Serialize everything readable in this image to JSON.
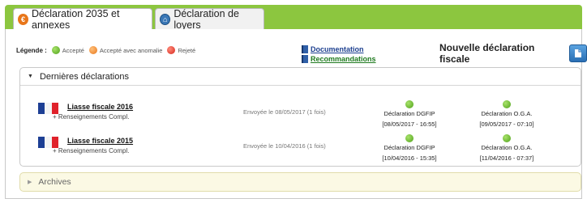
{
  "tabs": [
    {
      "label": "Déclaration 2035 et annexes",
      "icon": "euro-icon",
      "active": true
    },
    {
      "label": "Déclaration de loyers",
      "icon": "home-icon",
      "active": false
    }
  ],
  "legend": {
    "label": "Légende :",
    "items": [
      {
        "label": "Accepté",
        "color": "#4ea01a"
      },
      {
        "label": "Accepté avec anomalie",
        "color": "#e8761a"
      },
      {
        "label": "Rejeté",
        "color": "#d6261b"
      }
    ]
  },
  "links": {
    "documentation": "Documentation",
    "recommandations": "Recommandations"
  },
  "new_declaration": {
    "label": "Nouvelle déclaration fiscale"
  },
  "recent": {
    "title": "Dernières déclarations",
    "rows": [
      {
        "title": "Liasse fiscale 2016",
        "sub": "+ Renseignements Compl.",
        "sent": "Envoyée le 08/05/2017 (1 fois)",
        "dgfip_label": "Déclaration DGFIP",
        "dgfip_date": "[08/05/2017 - 16:55]",
        "oga_label": "Déclaration O.G.A.",
        "oga_date": "[09/05/2017 - 07:10]"
      },
      {
        "title": "Liasse fiscale 2015",
        "sub": "+ Renseignements Compl.",
        "sent": "Envoyée le 10/04/2016 (1 fois)",
        "dgfip_label": "Déclaration DGFIP",
        "dgfip_date": "[10/04/2016 - 15:35]",
        "oga_label": "Déclaration O.G.A.",
        "oga_date": "[11/04/2016 - 07:37]"
      }
    ]
  },
  "archives": {
    "title": "Archives"
  }
}
